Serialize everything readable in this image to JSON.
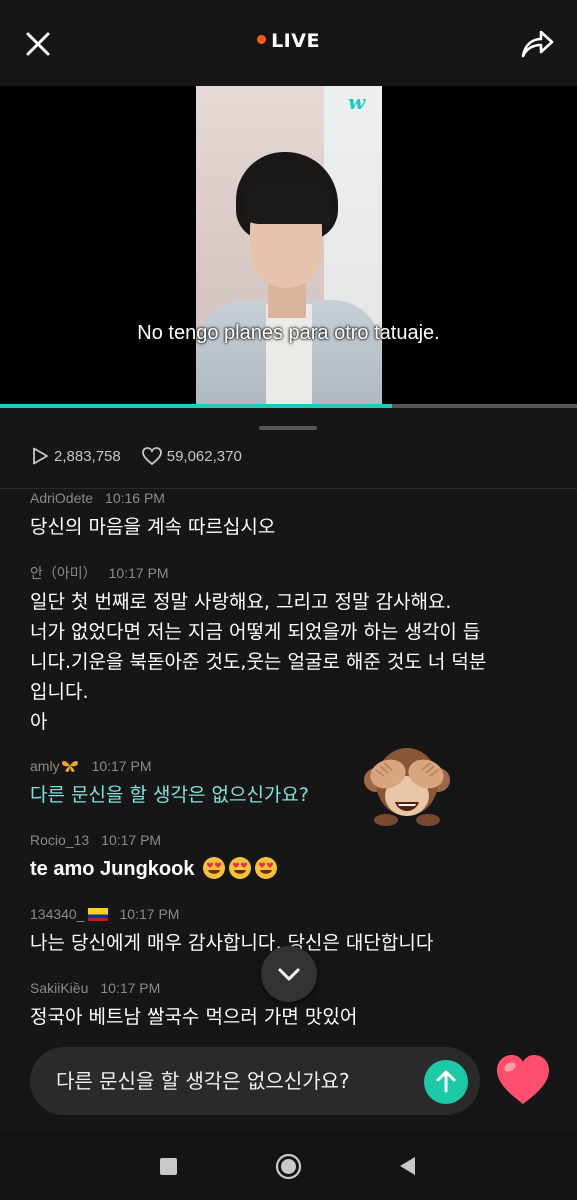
{
  "header": {
    "live_label": "LIVE",
    "close_icon": "close-icon",
    "share_icon": "share-icon",
    "accent_color": "#ff5a1f"
  },
  "video": {
    "subtitle": "No tengo planes para otro tatuaje.",
    "logo": "w",
    "progress_fraction": 0.68,
    "progress_color": "#22c8b9"
  },
  "stats": {
    "views": "2,883,758",
    "likes": "59,062,370"
  },
  "comments": [
    {
      "user": "AdriOdete",
      "time": "10:16 PM",
      "text": "당신의 마음을 계속 따르십시오"
    },
    {
      "user": "안（아미）",
      "time": "10:17 PM",
      "lines": [
        "일단 첫 번째로 정말 사랑해요, 그리고 정말 감사해요.",
        "너가 없었다면 저는 지금 어떻게 되었을까 하는 생각이 듭",
        "니다.기운을 북돋아준 것도,웃는 얼굴로 해준 것도 너 덕분",
        "입니다.",
        "아"
      ]
    },
    {
      "user": "amly",
      "time": "10:17 PM",
      "text": "다른 문신을 할 생각은 없으신가요?",
      "highlight": true,
      "sticker": "see-no-evil-monkey"
    },
    {
      "user": "Rocio_13",
      "time": "10:17 PM",
      "text": "te amo Jungkook"
    },
    {
      "user": "134340_",
      "time": "10:17 PM",
      "text": "나는 당신에게 매우 감사합니다, 당신은 대단합니다"
    },
    {
      "user": "SakiiKiều",
      "time": "10:17 PM",
      "text": "정국아 베트남 쌀국수 먹으러 가면 맛있어"
    }
  ],
  "input": {
    "value": "다른 문신을 할 생각은 없으신가요?",
    "send_color": "#1ec9a9",
    "like_color": "#ff4f6e"
  }
}
